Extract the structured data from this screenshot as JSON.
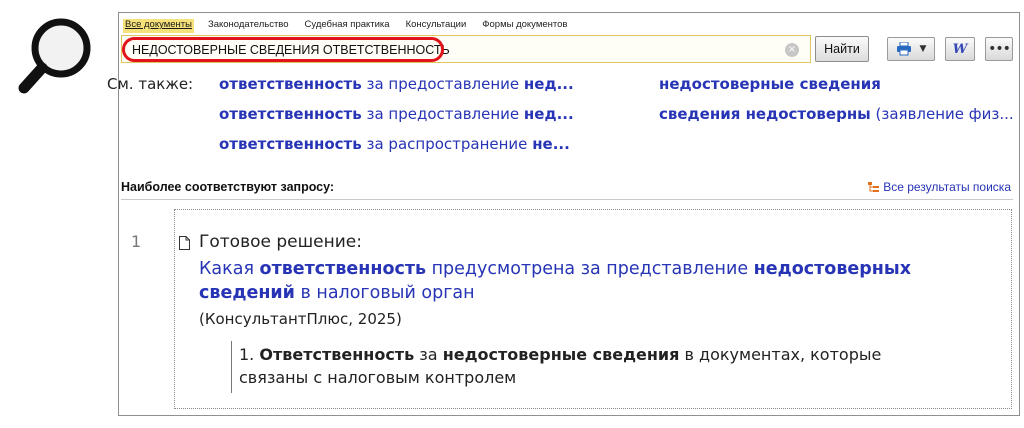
{
  "tabs": [
    {
      "label": "Все документы",
      "active": true
    },
    {
      "label": "Законодательство",
      "active": false
    },
    {
      "label": "Судебная практика",
      "active": false
    },
    {
      "label": "Консультации",
      "active": false
    },
    {
      "label": "Формы документов",
      "active": false
    }
  ],
  "search": {
    "query": "НЕДОСТОВЕРНЫЕ СВЕДЕНИЯ ОТВЕТСТВЕННОСТЬ",
    "clear_glyph": "×",
    "find_label": "Найти",
    "highlight_color": "#e0141a"
  },
  "toolbar": {
    "print_icon": "printer-icon",
    "dropdown_icon": "chevron-down-icon",
    "word_label": "W",
    "more_label": "•••"
  },
  "see_also": {
    "label": "См. также:",
    "links": [
      {
        "bold1": "ответственность",
        "normal": " за предоставление ",
        "bold2": "нед..."
      },
      {
        "bold1": "ответственность",
        "normal": " за предоставление ",
        "bold2": "нед..."
      },
      {
        "bold1": "ответственность",
        "normal": " за распространение ",
        "bold2": "не..."
      },
      {
        "bold1": "недостоверные сведения",
        "normal": "",
        "bold2": ""
      },
      {
        "bold1": "сведения недостоверны",
        "normal": " (заявление физ...",
        "bold2": ""
      }
    ]
  },
  "results_header": {
    "best_label": "Наиболее соответствуют запросу:",
    "all_results_label": "Все результаты поиска"
  },
  "result": {
    "number": "1",
    "kind": "Готовое решение:",
    "title": {
      "p1": "Какая ",
      "b1": "ответственность",
      "p2": " предусмотрена за представление ",
      "b2": "недостоверных сведений",
      "p3": " в налоговый орган"
    },
    "source": "(КонсультантПлюс, 2025)",
    "quote": {
      "p1": "1. ",
      "b1": "Ответственность",
      "p2": " за ",
      "b2": "недостоверные сведения",
      "p3": " в документах, которые связаны с налоговым контролем"
    }
  },
  "colors": {
    "link": "#2734b5",
    "active_tab": "#f6e27a",
    "search_border": "#e1c55d"
  }
}
